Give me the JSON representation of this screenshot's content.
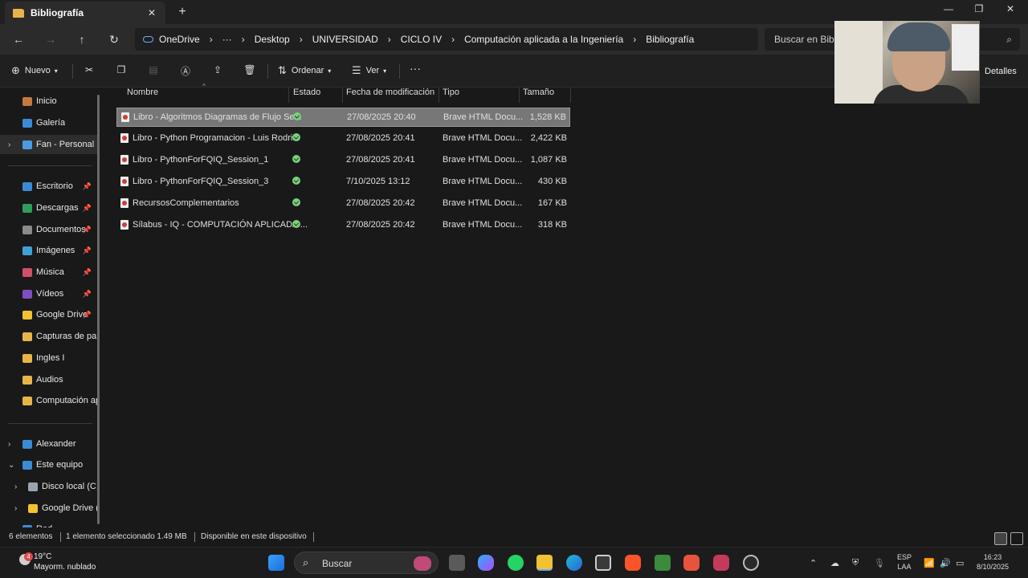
{
  "window": {
    "tab_title": "Bibliografía",
    "tab_close": "✕",
    "new_tab": "+",
    "minimize": "—",
    "maximize": "❐",
    "close": "✕"
  },
  "nav": {
    "back": "←",
    "forward": "→",
    "up": "↑",
    "refresh": "↻",
    "breadcrumbs": [
      "OneDrive",
      "···",
      "Desktop",
      "UNIVERSIDAD",
      "CICLO IV",
      "Computación aplicada a la Ingeniería",
      "Bibliografía"
    ],
    "search_placeholder": "Buscar en Bibli"
  },
  "commands": {
    "new_label": "Nuevo",
    "sort_label": "Ordenar",
    "view_label": "Ver",
    "more": "···",
    "details_label": "Detalles"
  },
  "sidebar": {
    "items": [
      {
        "label": "Inicio",
        "color": "#c47a3c",
        "pinned": false
      },
      {
        "label": "Galería",
        "color": "#3c8ad6",
        "pinned": false
      },
      {
        "label": "Fan - Personal",
        "color": "#4a9be0",
        "pinned": false,
        "expandable": true,
        "active": true
      },
      {
        "label": "Escritorio",
        "color": "#3b8bd4",
        "pinned": true
      },
      {
        "label": "Descargas",
        "color": "#2f9e5c",
        "pinned": true
      },
      {
        "label": "Documentos",
        "color": "#8a8a8a",
        "pinned": true
      },
      {
        "label": "Imágenes",
        "color": "#3fa0d8",
        "pinned": true
      },
      {
        "label": "Música",
        "color": "#d24f6b",
        "pinned": true
      },
      {
        "label": "Vídeos",
        "color": "#7b4fc2",
        "pinned": true
      },
      {
        "label": "Google Drive",
        "color": "#f2c230",
        "pinned": true
      },
      {
        "label": "Capturas de par",
        "color": "#e8b44a",
        "pinned": false
      },
      {
        "label": "Ingles I",
        "color": "#e8b44a",
        "pinned": false
      },
      {
        "label": "Audios",
        "color": "#e8b44a",
        "pinned": false
      },
      {
        "label": "Computación ap",
        "color": "#e8b44a",
        "pinned": false
      },
      {
        "label": "Alexander",
        "color": "#3b8bd4",
        "pinned": false,
        "expandable": true
      },
      {
        "label": "Este equipo",
        "color": "#3b8bd4",
        "pinned": false,
        "expanded": true
      },
      {
        "label": "Disco local (C:",
        "color": "#9aa4b0",
        "pinned": false,
        "expandable": true,
        "indent": true
      },
      {
        "label": "Google Drive (",
        "color": "#f2c230",
        "pinned": false,
        "expandable": true,
        "indent": true
      },
      {
        "label": "Red",
        "color": "#3b8bd4",
        "pinned": false,
        "expandable": true
      }
    ]
  },
  "table": {
    "headers": {
      "name": "Nombre",
      "status": "Estado",
      "date": "Fecha de modificación",
      "type": "Tipo",
      "size": "Tamaño"
    },
    "rows": [
      {
        "name": "Libro - Algoritmos Diagramas de Flujo Se...",
        "date": "27/08/2025 20:40",
        "type": "Brave HTML Docu...",
        "size": "1,528 KB",
        "selected": true
      },
      {
        "name": "Libro - Python Programacion - Luis Rodri...",
        "date": "27/08/2025 20:41",
        "type": "Brave HTML Docu...",
        "size": "2,422 KB"
      },
      {
        "name": "Libro - PythonForFQIQ_Session_1",
        "date": "27/08/2025 20:41",
        "type": "Brave HTML Docu...",
        "size": "1,087 KB"
      },
      {
        "name": "Libro - PythonForFQIQ_Session_3",
        "date": "7/10/2025 13:12",
        "type": "Brave HTML Docu...",
        "size": "430 KB"
      },
      {
        "name": "RecursosComplementarios",
        "date": "27/08/2025 20:42",
        "type": "Brave HTML Docu...",
        "size": "167 KB"
      },
      {
        "name": "Sílabus - IQ - COMPUTACIÓN APLICADA ...",
        "date": "27/08/2025 20:42",
        "type": "Brave HTML Docu...",
        "size": "318 KB"
      }
    ]
  },
  "statusbar": {
    "count": "6 elementos",
    "selection": "1 elemento seleccionado  1.49 MB",
    "availability": "Disponible en este dispositivo"
  },
  "taskbar": {
    "weather_badge": "4",
    "temperature": "19°C",
    "condition": "Mayorm. nublado",
    "search_label": "Buscar",
    "lang_top": "ESP",
    "lang_bottom": "LAA",
    "time": "16:23",
    "date": "8/10/2025"
  }
}
